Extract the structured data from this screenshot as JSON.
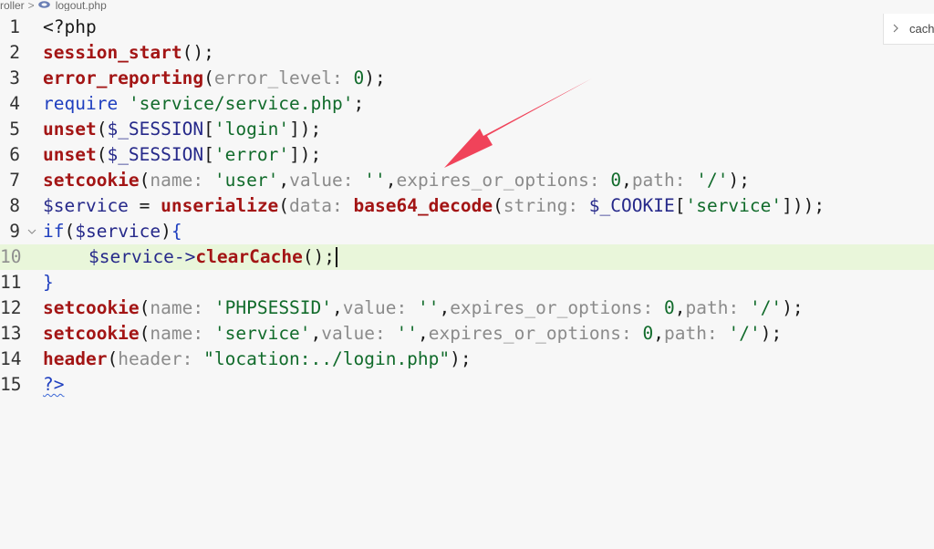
{
  "breadcrumb": {
    "parent": "roller",
    "separator": ">",
    "file": "logout.php",
    "file_icon": "php-file-icon"
  },
  "structure_tab": {
    "label": "cach",
    "icon": "chevron-right-icon"
  },
  "editor": {
    "current_line": 10,
    "lines": [
      {
        "num": "1",
        "t": [
          "<?php"
        ]
      },
      {
        "num": "2",
        "t": [
          "session_start",
          "();"
        ]
      },
      {
        "num": "3",
        "t": [
          "error_reporting",
          "(",
          "error_level: ",
          "0",
          ");"
        ]
      },
      {
        "num": "4",
        "t": [
          "require",
          " ",
          "'service/service.php'",
          ";"
        ]
      },
      {
        "num": "5",
        "t": [
          "unset",
          "(",
          "$_SESSION",
          "[",
          "'login'",
          "]);"
        ]
      },
      {
        "num": "6",
        "t": [
          "unset",
          "(",
          "$_SESSION",
          "[",
          "'error'",
          "]);"
        ]
      },
      {
        "num": "7",
        "t": [
          "setcookie",
          "(",
          "name: ",
          "'user'",
          ",",
          "value: ",
          "''",
          ",",
          "expires_or_options: ",
          "0",
          ",",
          "path: ",
          "'/'",
          ");"
        ]
      },
      {
        "num": "8",
        "t": [
          "$service",
          " = ",
          "unserialize",
          "(",
          "data: ",
          "base64_decode",
          "(",
          "string: ",
          "$_COOKIE",
          "[",
          "'service'",
          "]));"
        ]
      },
      {
        "num": "9",
        "t": [
          "if",
          "(",
          "$service",
          ")",
          "{"
        ]
      },
      {
        "num": "10",
        "t": [
          "$service",
          "->",
          "clearCache",
          "();"
        ]
      },
      {
        "num": "11",
        "t": [
          "}"
        ]
      },
      {
        "num": "12",
        "t": [
          "setcookie",
          "(",
          "name: ",
          "'PHPSESSID'",
          ",",
          "value: ",
          "''",
          ",",
          "expires_or_options: ",
          "0",
          ",",
          "path: ",
          "'/'",
          ");"
        ]
      },
      {
        "num": "13",
        "t": [
          "setcookie",
          "(",
          "name: ",
          "'service'",
          ",",
          "value: ",
          "''",
          ",",
          "expires_or_options: ",
          "0",
          ",",
          "path: ",
          "'/'",
          ");"
        ]
      },
      {
        "num": "14",
        "t": [
          "header",
          "(",
          "header: ",
          "\"location:../login.php\"",
          ");"
        ]
      },
      {
        "num": "15",
        "t": [
          "?>"
        ]
      }
    ]
  },
  "annotation": {
    "arrow_color": "#f0435a"
  },
  "colors": {
    "background": "#f7f7f7",
    "current_line": "#e9f6da",
    "function": "#a31515",
    "keyword": "#1f3fbf",
    "string": "#116b2b",
    "param_hint": "#8b8b8b",
    "variable": "#26298a"
  }
}
